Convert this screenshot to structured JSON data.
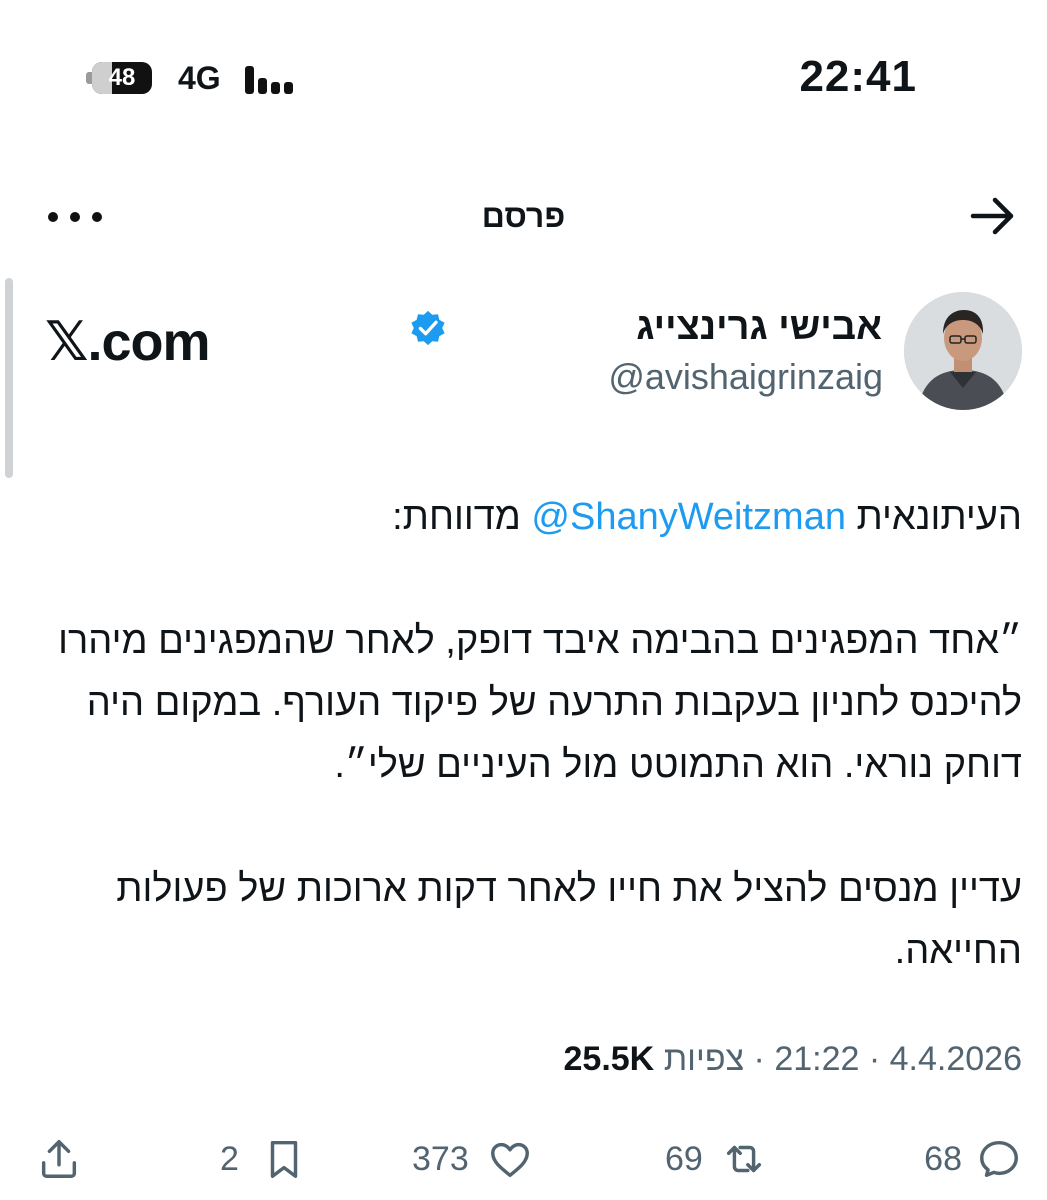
{
  "status_bar": {
    "time": "22:41",
    "battery": "48",
    "network": "4G"
  },
  "header": {
    "title": "פרסם",
    "back_icon": "arrow-right-icon",
    "more_icon": "more-dots-icon"
  },
  "author": {
    "name": "אבישי גרינצייג",
    "handle": "@avishaigrinzaig",
    "verified_icon": "verified-badge-icon",
    "verified_color": "#1d9bf0",
    "watermark": "𝕏.com"
  },
  "tweet": {
    "line1_prefix": "העיתונאית ",
    "mention": "@ShanyWeitzman",
    "line1_suffix": " מדווחת:",
    "quote": "״אחד המפגינים בהבימה איבד דופק, לאחר שהמפגינים מיהרו להיכנס לחניון בעקבות התרעה של פיקוד העורף. במקום היה דוחק נוראי. הוא התמוטט מול העיניים שלי״.",
    "update": "עדיין מנסים להציל את חייו לאחר דקות ארוכות של פעולות החייאה."
  },
  "meta": {
    "date": "4.4.2026",
    "sep1": " · ",
    "time": "21:22",
    "sep2": " · ",
    "views_label": "צפיות",
    "views_count": "25.5K"
  },
  "actions": {
    "replies": "68",
    "reposts": "69",
    "likes": "373",
    "bookmarks": "2"
  },
  "colors": {
    "text": "#0f1419",
    "secondary": "#536471",
    "link": "#1d9bf0"
  }
}
